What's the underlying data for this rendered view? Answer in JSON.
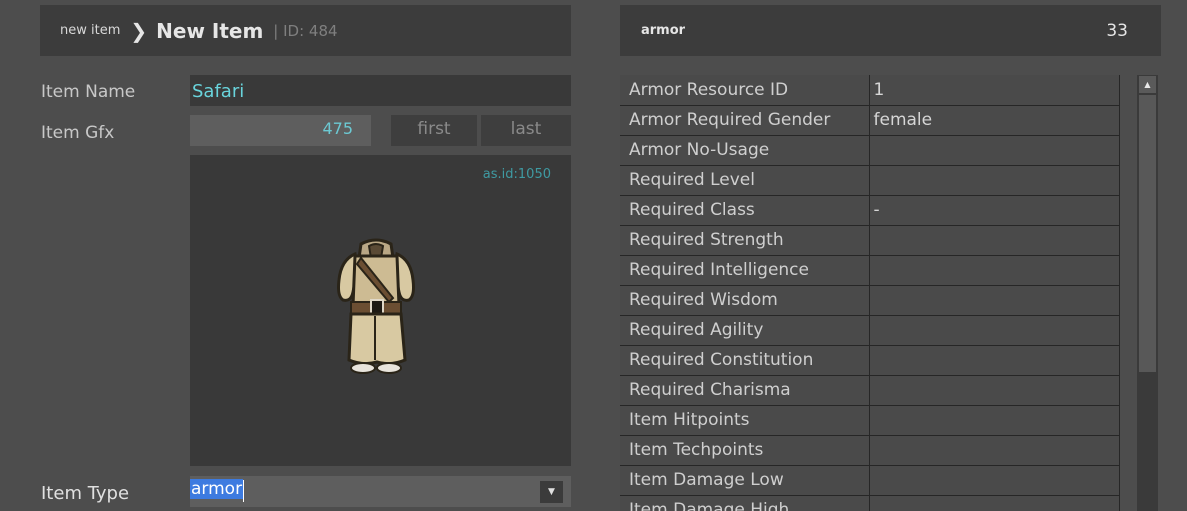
{
  "header": {
    "breadcrumb_root": "new item",
    "chevron": "❯",
    "title": "New Item",
    "id_text": "| ID: 484"
  },
  "side_header": {
    "type": "armor",
    "count": "33"
  },
  "form": {
    "item_name_label": "Item Name",
    "item_name_value": "Safari",
    "item_gfx_label": "Item Gfx",
    "item_gfx_value": "475",
    "first_label": "first",
    "last_label": "last",
    "resource_id_text": "as.id:1050",
    "item_type_label": "Item Type",
    "item_type_value": "armor",
    "dropdown_icon": "dropdown-arrow-icon"
  },
  "properties": [
    {
      "key": "Armor Resource ID",
      "value": "1"
    },
    {
      "key": "Armor Required Gender",
      "value": "female"
    },
    {
      "key": "Armor No-Usage",
      "value": ""
    },
    {
      "key": "Required Level",
      "value": ""
    },
    {
      "key": "Required Class",
      "value": "-"
    },
    {
      "key": "Required Strength",
      "value": ""
    },
    {
      "key": "Required Intelligence",
      "value": ""
    },
    {
      "key": "Required Wisdom",
      "value": ""
    },
    {
      "key": "Required Agility",
      "value": ""
    },
    {
      "key": "Required Constitution",
      "value": ""
    },
    {
      "key": "Required Charisma",
      "value": ""
    },
    {
      "key": "Item Hitpoints",
      "value": ""
    },
    {
      "key": "Item Techpoints",
      "value": ""
    },
    {
      "key": "Item Damage Low",
      "value": ""
    },
    {
      "key": "Item Damage High",
      "value": ""
    }
  ],
  "colors": {
    "background": "#4d4d4d",
    "panel": "#3c3c3c",
    "accent_cyan": "#69d4dc",
    "selection_blue": "#3d7be0"
  }
}
